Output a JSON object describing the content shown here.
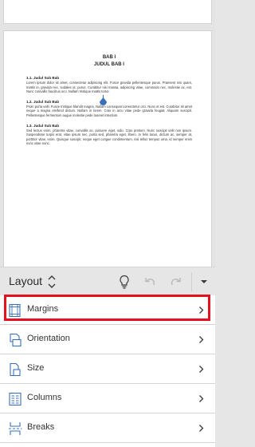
{
  "document": {
    "title": "BAB I",
    "subtitle": "JUDUL BAB I",
    "sections": [
      {
        "heading": "1.1.   Judul Sub Bab",
        "body": "Lorem ipsum dolor sit amet, consectetur adipiscing elit. Fusce gravida pellentesque purus. Praesent nisi quam, mattis in, gravida nec, sodales ut, purus. Curabitur nisi massa, adipiscing vitae, commodo nec, molestie ac, est. Nunc convallis faucibus orci. Nullam tristique mattis tortor."
      },
      {
        "heading": "1.2.   Judul Sub Bab",
        "body": "Proin porta velit. Fusce tristique blandit magna. Nullam consequat consectetur orci. Nunc et est. Curabitur sit amet neque a magna eleifend dictum. Nullam in lorem. Cras in arcu vitae pede gravida feugiat. Aliquam suscipit. Pellentesque fermentum augue molestie pede laoreet interdum."
      },
      {
        "heading": "1.3.   Judul Sub Bab",
        "body": "Sed lectus enim, pharetra vitae, convallis ac, posuere eget, odio. Cras pretium. Nunc suscipit velit non ipsum. Suspendisse turpis erat, vitae ipsum nec, porta sed, pharetra eget, libero. In felis lacus, dictum ac, semper at, porttitor vitae, enim. Quisque suscipit, neque eget congue condimentum, nisi tellus tempus urna, id semper enim nunc vitae nunc."
      }
    ]
  },
  "layout_bar": {
    "label": "Layout",
    "icons": [
      "lightbulb-icon",
      "undo-icon",
      "redo-icon",
      "dropdown-arrow-icon"
    ]
  },
  "menu": {
    "items": [
      {
        "label": "Margins",
        "icon": "margins-icon",
        "highlighted": true
      },
      {
        "label": "Orientation",
        "icon": "orientation-icon"
      },
      {
        "label": "Size",
        "icon": "size-icon"
      },
      {
        "label": "Columns",
        "icon": "columns-icon"
      },
      {
        "label": "Breaks",
        "icon": "breaks-icon"
      }
    ]
  },
  "colors": {
    "highlight": "#e3101d",
    "icon_blue": "#3b6fb5",
    "icon_gray": "#b9b9b9",
    "bar_background": "#e6e6e6"
  }
}
